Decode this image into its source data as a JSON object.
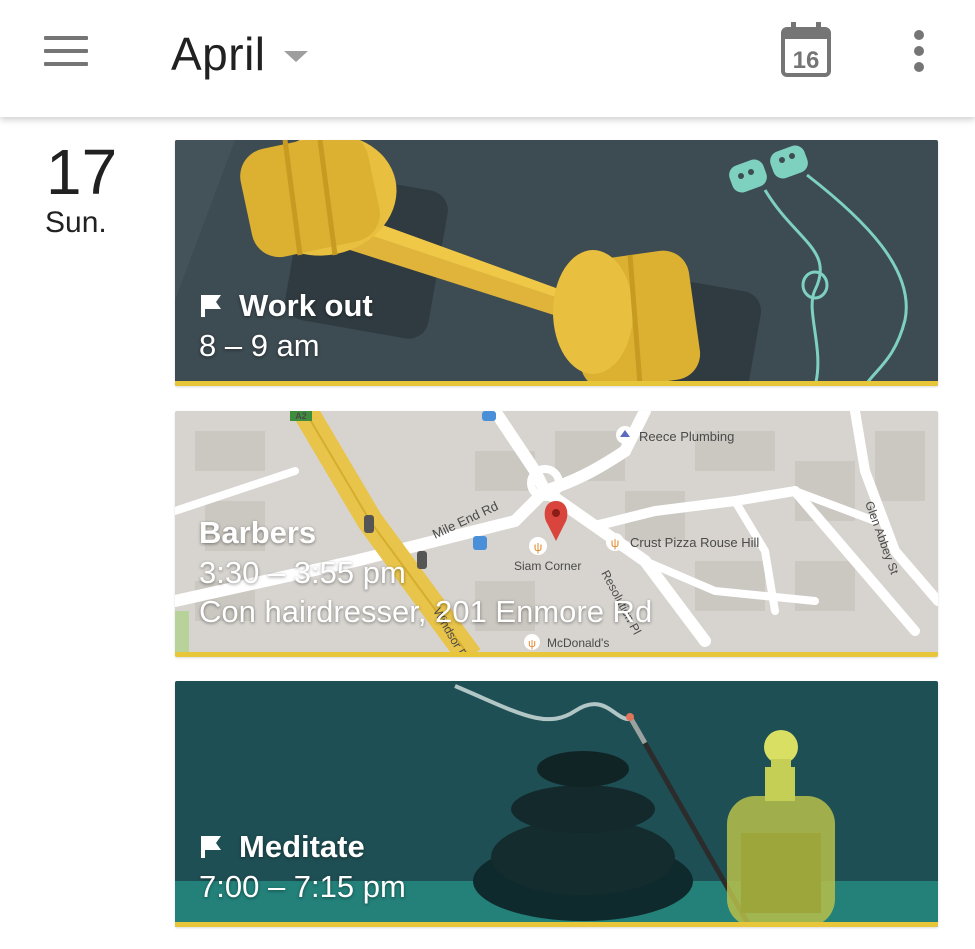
{
  "header": {
    "menu_icon": "hamburger-menu-icon",
    "title": "April",
    "today_icon": "calendar-today-icon",
    "today_date": "16",
    "more_icon": "more-vert-icon"
  },
  "day": {
    "number": "17",
    "weekday": "Sun."
  },
  "events": [
    {
      "title": "Work out",
      "time": "8 – 9 am",
      "icon": "flag-icon",
      "color": "#e8c63a"
    },
    {
      "title": "Barbers",
      "time": "3:30 – 3:55 pm",
      "location": "Con hairdresser, 201 Enmore Rd",
      "color": "#e8c63a"
    },
    {
      "title": "Meditate",
      "time": "7:00 – 7:15 pm",
      "icon": "flag-icon",
      "color": "#e8c63a"
    }
  ],
  "map": {
    "labels": {
      "reece": "Reece Plumbing",
      "mileend": "Mile End Rd",
      "crust": "Crust Pizza Rouse Hill",
      "siam": "Siam Corner",
      "resolution": "Resolution Pl",
      "glenabbey": "Glen Abbey St",
      "mcdonalds": "McDonald's",
      "windsor": "Windsor Rd",
      "a2": "A2"
    }
  }
}
